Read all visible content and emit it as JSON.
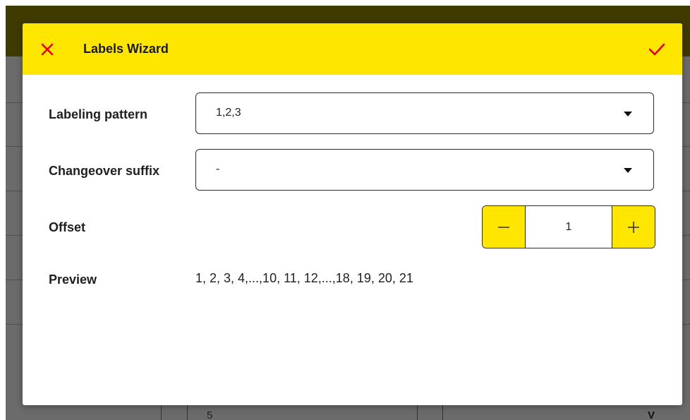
{
  "dialog": {
    "title": "Labels Wizard",
    "close_icon": "close-icon",
    "confirm_icon": "check-icon"
  },
  "form": {
    "labeling_pattern": {
      "label": "Labeling pattern",
      "value": "1,2,3"
    },
    "changeover_suffix": {
      "label": "Changeover suffix",
      "value": "-"
    },
    "offset": {
      "label": "Offset",
      "value": "1",
      "minus_icon": "minus-icon",
      "plus_icon": "plus-icon"
    },
    "preview": {
      "label": "Preview",
      "value": "1, 2, 3, 4,...,10, 11, 12,...,18, 19, 20, 21"
    }
  },
  "background": {
    "row_value": "5",
    "row_letter": "V"
  },
  "colors": {
    "accent": "#ffe600",
    "icon_red": "#e2001a",
    "backdrop": "#6b6b6b"
  }
}
